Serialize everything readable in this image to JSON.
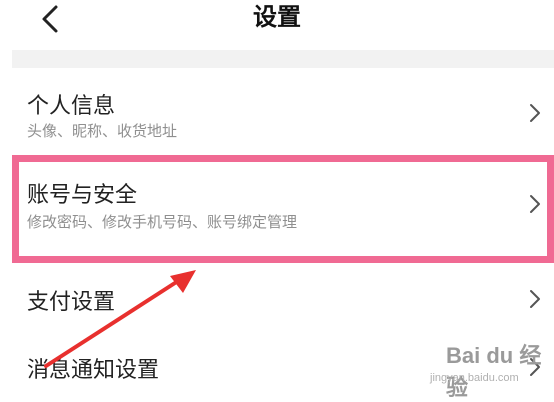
{
  "header": {
    "title": "设置"
  },
  "rows": [
    {
      "title": "个人信息",
      "subtitle": "头像、昵称、收货地址"
    },
    {
      "title": "账号与安全",
      "subtitle": "修改密码、修改手机号码、账号绑定管理"
    },
    {
      "title": "支付设置",
      "subtitle": ""
    },
    {
      "title": "消息通知设置",
      "subtitle": ""
    }
  ],
  "highlight_color": "#f06a93",
  "annotation_arrow_color": "#e8302e",
  "watermark": {
    "brand": "Bai du 经验",
    "url": "jingyan.baidu.com"
  }
}
